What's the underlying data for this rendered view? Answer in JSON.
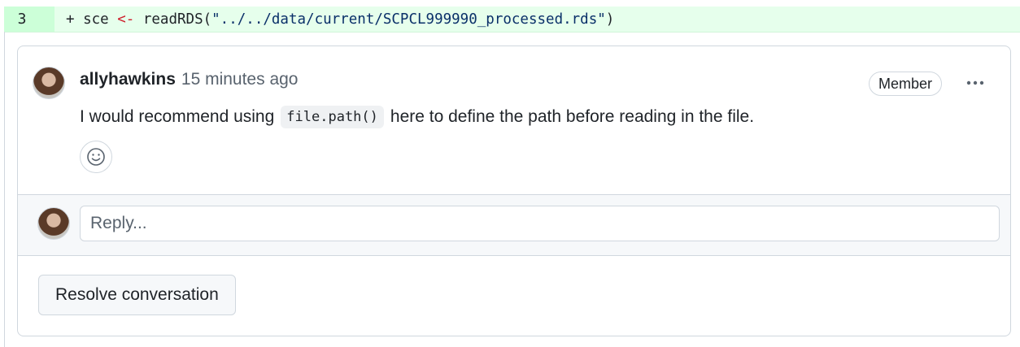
{
  "diff": {
    "line_number": "3",
    "prefix": "+ ",
    "var": "sce ",
    "op": "<-",
    "call": " readRDS(",
    "string": "\"../../data/current/SCPCL999990_processed.rds\"",
    "close": ")",
    "background": "#e6ffec"
  },
  "comment": {
    "author": "allyhawkins",
    "timestamp": "15 minutes ago",
    "role_badge": "Member",
    "more_icon": "kebab-horizontal-icon",
    "body_before": "I would recommend using",
    "inline_code": "file.path()",
    "body_after": "here to define the path before reading in the file.",
    "reaction_icon": "smiley-icon"
  },
  "reply": {
    "placeholder": "Reply..."
  },
  "actions": {
    "resolve_label": "Resolve conversation"
  }
}
